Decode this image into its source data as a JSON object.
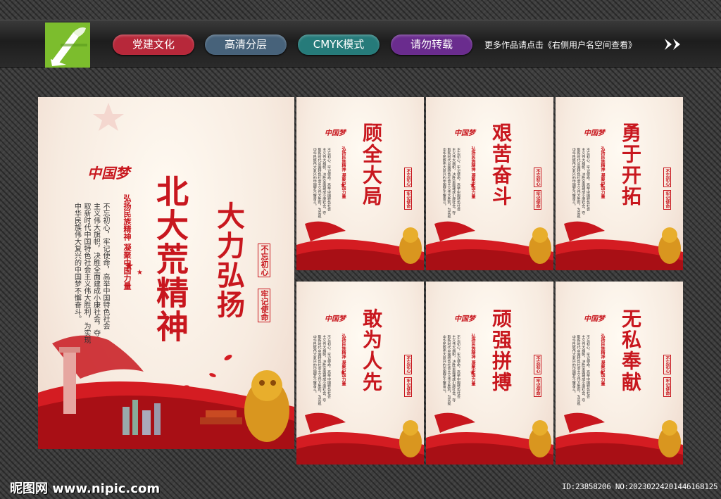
{
  "header": {
    "tags": [
      "党建文化",
      "高清分层",
      "CMYK模式",
      "请勿转载"
    ],
    "more_text": "更多作品请点击《右侧用户名空间查看》"
  },
  "main_poster": {
    "brand": "中国梦",
    "title": "北大荒精神",
    "subtitle": "大力弘扬",
    "stamps": [
      "不忘初心",
      "牢记使命"
    ],
    "slogan": "弘扬民族精神 凝聚中国力量",
    "body": "不忘初心，牢记使命，高举中国特色社会\n主义伟大旗帜，决胜全面建成小康社会，夺\n取新时代中国特色社会主义伟大胜利，为实现\n中华民族伟大复兴的中国梦不懈奋斗。"
  },
  "small_posters": [
    {
      "title": "顾全大局"
    },
    {
      "title": "艰苦奋斗"
    },
    {
      "title": "勇于开拓"
    },
    {
      "title": "敢为人先"
    },
    {
      "title": "顽强拼搏"
    },
    {
      "title": "无私奉献"
    }
  ],
  "footer": {
    "site": "昵图网 www.nipic.com",
    "id_text": "ID:23858206 NO:20230224201446168125"
  },
  "colors": {
    "accent": "#c8171e",
    "logo_green": "#7cbd2d"
  }
}
